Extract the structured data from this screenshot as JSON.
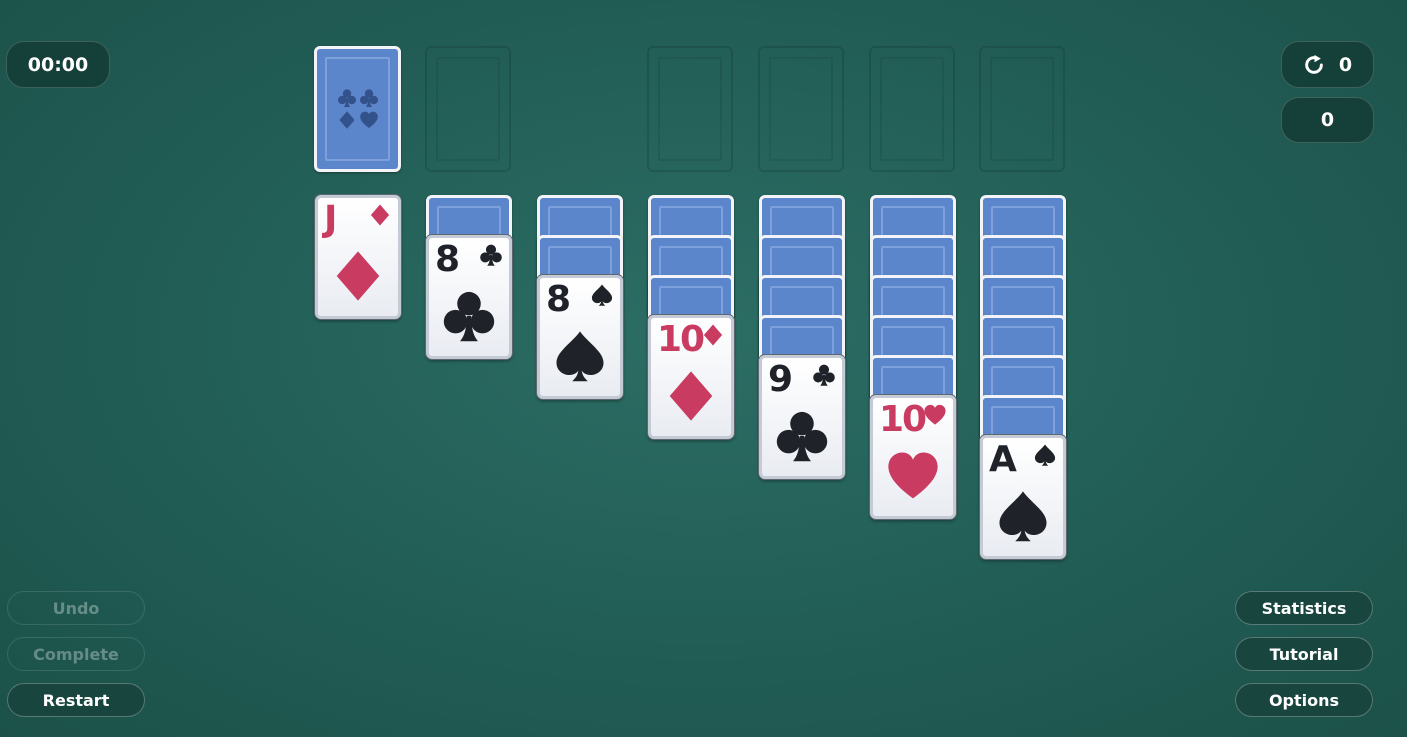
{
  "hud": {
    "timer": "00:00",
    "moves": "0",
    "score": "0"
  },
  "buttons": {
    "undo": "Undo",
    "complete": "Complete",
    "restart": "Restart",
    "statistics": "Statistics",
    "tutorial": "Tutorial",
    "options": "Options"
  },
  "tableau": [
    {
      "face_down": 0,
      "top": {
        "rank": "J",
        "suit": "diamonds"
      }
    },
    {
      "face_down": 1,
      "top": {
        "rank": "8",
        "suit": "clubs"
      }
    },
    {
      "face_down": 2,
      "top": {
        "rank": "8",
        "suit": "spades"
      }
    },
    {
      "face_down": 3,
      "top": {
        "rank": "10",
        "suit": "diamonds"
      }
    },
    {
      "face_down": 4,
      "top": {
        "rank": "9",
        "suit": "clubs"
      }
    },
    {
      "face_down": 5,
      "top": {
        "rank": "10",
        "suit": "hearts"
      }
    },
    {
      "face_down": 6,
      "top": {
        "rank": "A",
        "suit": "spades"
      }
    }
  ],
  "colors": {
    "felt": "#236058",
    "card_back": "#5c86cc",
    "red_suit": "#c93b61",
    "black_suit": "#1f2329"
  }
}
